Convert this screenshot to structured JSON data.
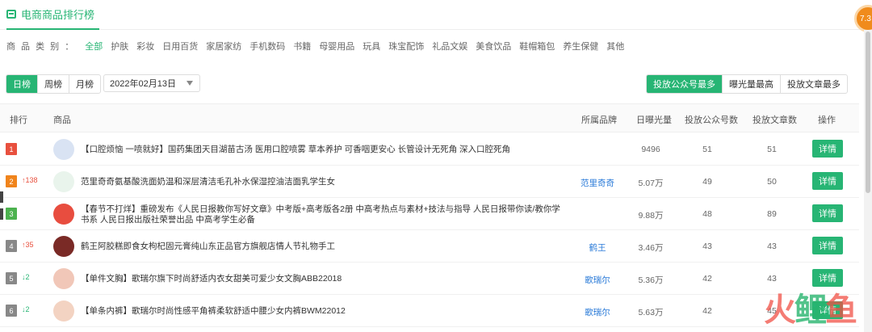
{
  "header": {
    "title": "电商商品排行榜"
  },
  "badge": "7.3",
  "categories": {
    "label": "商 品 类 别 ：",
    "items": [
      "全部",
      "护肤",
      "彩妆",
      "日用百货",
      "家居家纺",
      "手机数码",
      "书籍",
      "母婴用品",
      "玩具",
      "珠宝配饰",
      "礼品文娱",
      "美食饮品",
      "鞋帽箱包",
      "养生保健",
      "其他"
    ],
    "active": 0
  },
  "period": {
    "items": [
      "日榜",
      "周榜",
      "月榜"
    ],
    "active": 0
  },
  "date": {
    "value": "2022年02月13日"
  },
  "sort": {
    "items": [
      "投放公众号最多",
      "曝光量最高",
      "投放文章最多"
    ],
    "active": 0
  },
  "table": {
    "headers": {
      "rank": "排行",
      "product": "商品",
      "brand": "所属品牌",
      "exposure": "日曝光量",
      "accounts": "投放公众号数",
      "articles": "投放文章数",
      "action": "操作"
    },
    "rows": [
      {
        "rank": "1",
        "delta": "",
        "delta_dir": "",
        "name": "【口腔烦恼 一喷就好】国药集团天目湖苗古汤 医用口腔喷雾 草本养护 可香咽更安心 长管设计无死角 深入口腔死角",
        "brand": "",
        "exposure": "9496",
        "accounts": "51",
        "articles": "51",
        "action": "详情",
        "thumb_color": "#d9e3f3"
      },
      {
        "rank": "2",
        "delta": "↑138",
        "delta_dir": "up",
        "name": "范里奇奇氨基酸洗面奶温和深层清洁毛孔补水保湿控油洁面乳学生女",
        "brand": "范里奇奇",
        "exposure": "5.07万",
        "accounts": "49",
        "articles": "50",
        "action": "详情",
        "thumb_color": "#e9f4ec"
      },
      {
        "rank": "3",
        "delta": "",
        "delta_dir": "",
        "name": "【春节不打烊】重磅发布《人民日报教你写好文章》中考版+高考版各2册 中高考热点与素材+技法与指导 人民日报带你读/教你学书系 人民日报出版社荣誉出品 中高考学生必备",
        "brand": "",
        "exposure": "9.88万",
        "accounts": "48",
        "articles": "89",
        "action": "详情",
        "thumb_color": "#e84d3f"
      },
      {
        "rank": "4",
        "delta": "↑35",
        "delta_dir": "up",
        "name": "鹤王阿胶糕即食女枸杞固元膏纯山东正品官方旗舰店情人节礼物手工",
        "brand": "鹤王",
        "exposure": "3.46万",
        "accounts": "43",
        "articles": "43",
        "action": "详情",
        "thumb_color": "#7a2a26"
      },
      {
        "rank": "5",
        "delta": "↓2",
        "delta_dir": "down",
        "name": "【单件文胸】歌瑞尔旗下时尚舒适内衣女甜美可爱少女文胸ABB22018",
        "brand": "歌瑞尔",
        "exposure": "5.36万",
        "accounts": "42",
        "articles": "43",
        "action": "详情",
        "thumb_color": "#f1c7b8"
      },
      {
        "rank": "6",
        "delta": "↓2",
        "delta_dir": "down",
        "name": "【单条内裤】歌瑞尔时尚性感平角裤柔软舒适中腰少女内裤BWM22012",
        "brand": "歌瑞尔",
        "exposure": "5.63万",
        "accounts": "42",
        "articles": "45",
        "action": "详情",
        "thumb_color": "#f3d3c2"
      }
    ]
  },
  "watermark": {
    "part1": "火",
    "part2": "鲤",
    "part3": "鱼"
  }
}
